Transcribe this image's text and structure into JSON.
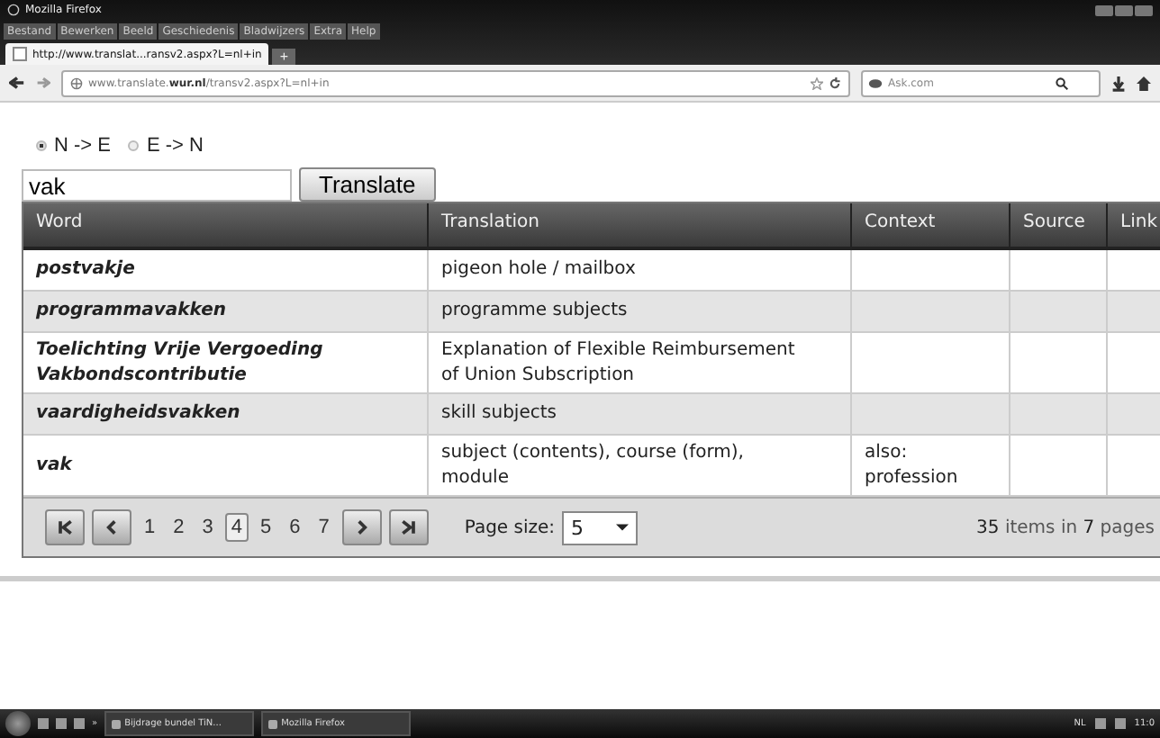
{
  "window": {
    "title": "Mozilla Firefox"
  },
  "menu": [
    "Bestand",
    "Bewerken",
    "Beeld",
    "Geschiedenis",
    "Bladwijzers",
    "Extra",
    "Help"
  ],
  "new_tab": "+",
  "tabs": [
    {
      "label": "http://www.translat...ransv2.aspx?L=nl+in",
      "selected": true
    }
  ],
  "address": {
    "pre": "www.translate.",
    "bold": "wur.nl",
    "post": "/transv2.aspx?L=nl+in"
  },
  "search_engine": {
    "placeholder": "Ask.com"
  },
  "direction": [
    {
      "label": "N -> E",
      "selected": true
    },
    {
      "label": "E -> N",
      "selected": false
    }
  ],
  "query": {
    "value": "vak"
  },
  "translate_button": "Translate",
  "table": {
    "columns": [
      "Word",
      "Translation",
      "Context",
      "Source",
      "Link"
    ],
    "rows": [
      {
        "word": "postvakje",
        "translation": "pigeon hole / mailbox",
        "context": ""
      },
      {
        "word": "programmavakken",
        "translation": "programme subjects",
        "context": ""
      },
      {
        "word": "Toelichting Vrije Vergoeding Vakbondscontributie",
        "translation": "Explanation of Flexible Reimbursement of Union Subscription",
        "context": ""
      },
      {
        "word": "vaardigheidsvakken",
        "translation": "skill subjects",
        "context": ""
      },
      {
        "word": "vak",
        "translation": "subject (contents), course (form), module",
        "context": "also: profession"
      }
    ]
  },
  "pager": {
    "pages": [
      {
        "label": "1",
        "selected": false
      },
      {
        "label": "2",
        "selected": false
      },
      {
        "label": "3",
        "selected": false
      },
      {
        "label": "4",
        "selected": true
      },
      {
        "label": "5",
        "selected": false
      },
      {
        "label": "6",
        "selected": false
      },
      {
        "label": "7",
        "selected": false
      }
    ],
    "page_size_label": "Page size:",
    "page_size": "5",
    "summary": "**35** items in **7** pages"
  },
  "taskbar": {
    "tasks": [
      "Bijdrage bundel TiN...",
      "Mozilla Firefox"
    ],
    "more": "»",
    "language": "NL",
    "clock": "11:0"
  }
}
